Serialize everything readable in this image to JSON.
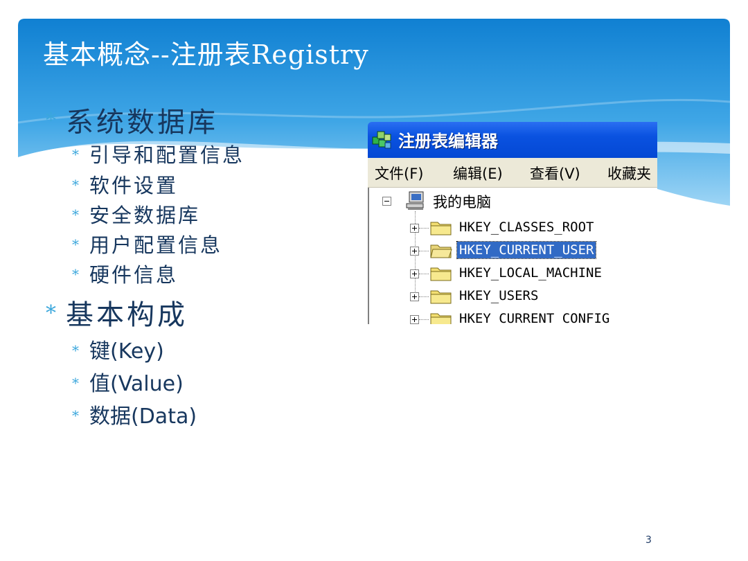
{
  "slide": {
    "title": "基本概念--注册表Registry",
    "page_number": "3"
  },
  "bullets": [
    {
      "level": 1,
      "text": "系统数据库"
    },
    {
      "level": 2,
      "text": "引导和配置信息"
    },
    {
      "level": 2,
      "text": "软件设置"
    },
    {
      "level": 2,
      "text": "安全数据库"
    },
    {
      "level": 2,
      "text": "用户配置信息"
    },
    {
      "level": 2,
      "text": "硬件信息"
    },
    {
      "level": 1,
      "text": "基本构成"
    },
    {
      "level": 2,
      "text": "键(Key)"
    },
    {
      "level": 2,
      "text": "值(Value)"
    },
    {
      "level": 2,
      "text": "数据(Data)"
    }
  ],
  "bullet_symbol": "*",
  "regedit": {
    "window_title": "注册表编辑器",
    "menu": [
      "文件(F)",
      "编辑(E)",
      "查看(V)",
      "收藏夹"
    ],
    "root_label": "我的电脑",
    "keys": [
      {
        "name": "HKEY_CLASSES_ROOT",
        "selected": false
      },
      {
        "name": "HKEY_CURRENT_USER",
        "selected": true
      },
      {
        "name": "HKEY_LOCAL_MACHINE",
        "selected": false
      },
      {
        "name": "HKEY_USERS",
        "selected": false
      },
      {
        "name": "HKEY_CURRENT_CONFIG",
        "selected": false
      }
    ]
  },
  "colors": {
    "header_blue": "#1a8fd8",
    "text_navy": "#17375e",
    "bullet_star": "#3ba7dc",
    "xp_titlebar": "#0a52e0",
    "selection": "#316ac5"
  }
}
